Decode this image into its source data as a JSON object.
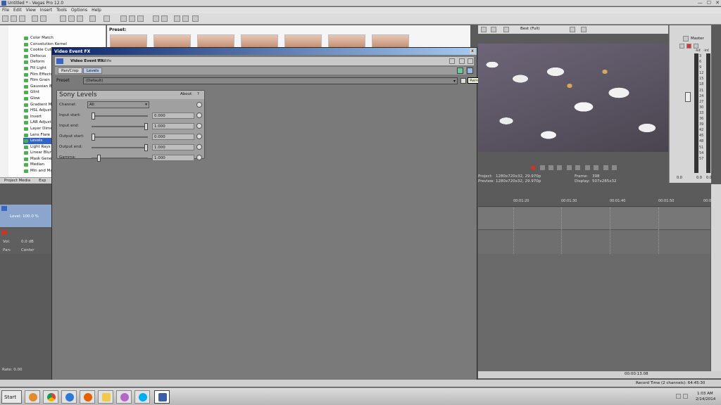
{
  "window": {
    "title": "Untitled * - Vegas Pro 12.0",
    "min": "—",
    "max": "☐",
    "close": "✕"
  },
  "menu": [
    "File",
    "Edit",
    "View",
    "Insert",
    "Tools",
    "Options",
    "Help"
  ],
  "explorer": {
    "items": [
      "Color Match",
      "Convolution Kernel",
      "Cookie Cutter",
      "Defocus",
      "Deform",
      "Fill Light",
      "Film Effects",
      "Film Grain",
      "Gaussian Blur",
      "Glint",
      "Glow",
      "Gradient Map",
      "HSL Adjust",
      "Invert",
      "LAB Adjust",
      "Layer Dimensionality",
      "Lens Flare",
      "Levels",
      "Light Rays",
      "Linear Blur",
      "Mask Generator",
      "Median",
      "Min and Max"
    ],
    "selected_index": 17,
    "preset_label": "Preset:",
    "tabs": [
      "Project Media",
      "Exp"
    ]
  },
  "tracks": {
    "video_level": "Level: 100.0 %",
    "audio_vol_label": "Vol:",
    "audio_vol_value": "0.0 dB",
    "audio_pan_label": "Pan:",
    "audio_pan_value": "Center",
    "rate": "Rate: 0.00"
  },
  "dialog": {
    "title": "Video Event FX",
    "close": "x",
    "fx_label": "Video Event FX:",
    "fx_value": "Wildlife",
    "chain_buttons": [
      "Pan/Crop",
      "Levels"
    ],
    "preset_label": "Preset",
    "preset_value": "(Default)",
    "tooltip": "Remove Selected Plug-In"
  },
  "levels": {
    "name": "Sony Levels",
    "about": "About",
    "help": "?",
    "channel_label": "Channel:",
    "channel_value": "All",
    "rows": [
      {
        "label": "Input start:",
        "value": "0.000",
        "level": 0.0
      },
      {
        "label": "Input end:",
        "value": "1.000",
        "level": 1.0
      },
      {
        "label": "Output start:",
        "value": "0.000",
        "level": 0.0
      },
      {
        "label": "Output end:",
        "value": "1.000",
        "level": 1.0
      },
      {
        "label": "Gamma:",
        "value": "1.000",
        "level": 0.1
      }
    ]
  },
  "preview": {
    "quality": "Best (Full)",
    "project_label": "Project:",
    "project_value": "1280x720x32, 29.970p",
    "preview_label": "Preview:",
    "preview_value": "1280x720x32, 29.970p",
    "frame_label": "Frame:",
    "frame_value": "398",
    "display_label": "Display:",
    "display_value": "507x285x32"
  },
  "master": {
    "label": "Master",
    "scale": [
      "3",
      "6",
      "9",
      "12",
      "15",
      "18",
      "21",
      "24",
      "27",
      "30",
      "33",
      "36",
      "39",
      "42",
      "45",
      "48",
      "51",
      "54",
      "57"
    ],
    "left_val": "0.0",
    "right_val": "0.0",
    "peak_left": "-Inf.",
    "peak_right": "-Inf."
  },
  "timeline": {
    "ticks": [
      "00:01:20",
      "00:01:30",
      "00:01:40",
      "00:01:50",
      "00:0"
    ],
    "timecode": "00:00:13.08"
  },
  "status": {
    "record_time": "Record Time (2 channels): 64:45:30"
  },
  "taskbar": {
    "start": "Start",
    "time": "1:03 AM",
    "date": "2/14/2014"
  }
}
